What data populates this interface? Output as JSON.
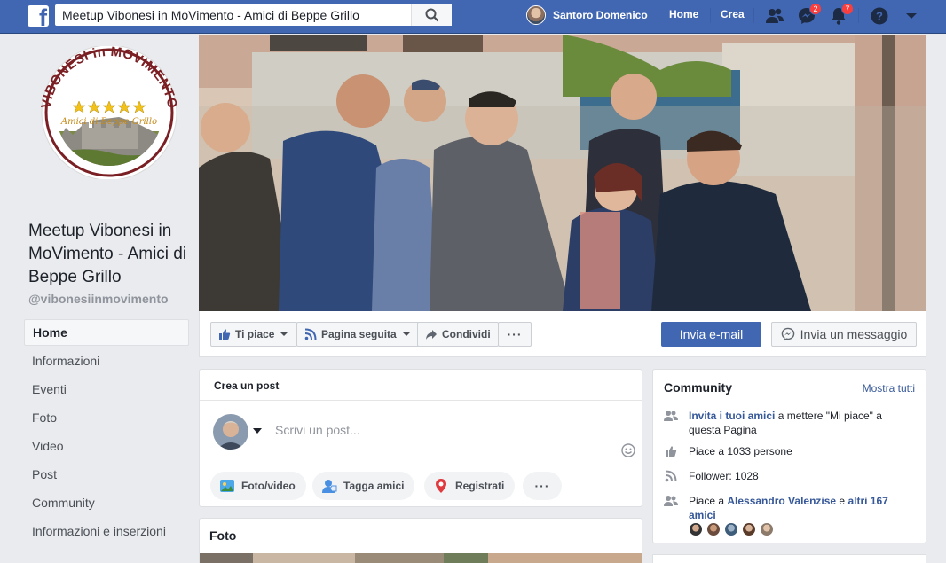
{
  "topbar": {
    "search_value": "Meetup Vibonesi in MoVimento - Amici di Beppe Grillo",
    "user_name": "Santoro Domenico",
    "home_label": "Home",
    "create_label": "Crea",
    "messages_badge": "2",
    "notifications_badge": "7"
  },
  "profile": {
    "logo_top_text": "VIBONESI in MOVIMENTO",
    "logo_sub_text": "Amici di Beppe Grillo",
    "page_name": "Meetup Vibonesi in MoVimento - Amici di Beppe Grillo",
    "handle": "@vibonesiinmovimento"
  },
  "leftnav": {
    "items": [
      {
        "label": "Home"
      },
      {
        "label": "Informazioni"
      },
      {
        "label": "Eventi"
      },
      {
        "label": "Foto"
      },
      {
        "label": "Video"
      },
      {
        "label": "Post"
      },
      {
        "label": "Community"
      },
      {
        "label": "Informazioni e inserzioni"
      }
    ]
  },
  "actions": {
    "like_label": "Ti piace",
    "follow_label": "Pagina seguita",
    "share_label": "Condividi",
    "more_label": "···",
    "email_label": "Invia e-mail",
    "message_label": "Invia un messaggio"
  },
  "composer": {
    "title": "Crea un post",
    "placeholder": "Scrivi un post...",
    "photo_label": "Foto/video",
    "tag_label": "Tagga amici",
    "checkin_label": "Registrati",
    "more_label": "···"
  },
  "foto_card": {
    "title": "Foto"
  },
  "community": {
    "title": "Community",
    "see_all": "Mostra tutti",
    "invite_link": "Invita i tuoi amici",
    "invite_rest": " a mettere \"Mi piace\" a questa Pagina",
    "likes_text": "Piace a 1033 persone",
    "followers_text": "Follower: 1028",
    "friends_prefix": "Piace a ",
    "friend_name": "Alessandro Valenzise",
    "friends_mid": " e ",
    "friends_others": "altri 167 amici"
  },
  "colors": {
    "brand": "#4267b2",
    "link": "#365899",
    "badge": "#fa3e3e"
  }
}
